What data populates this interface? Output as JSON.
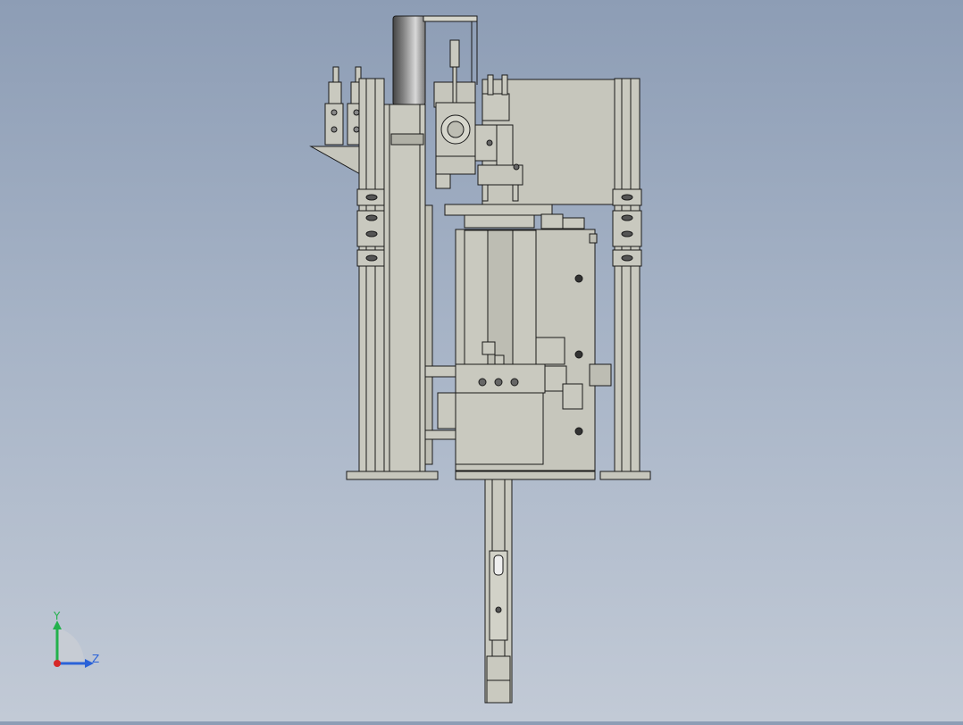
{
  "view": {
    "background_top": "#8d9db5",
    "background_bottom": "#c2cad6",
    "part_fill": "#c9c9bf",
    "part_shade": "#a9a99f",
    "edge_color": "#1a1a1a"
  },
  "triad": {
    "y_label": "Y",
    "z_label": "Z",
    "y_color": "#22b14c",
    "z_color": "#2a62d8",
    "x_color": "#d62828"
  }
}
